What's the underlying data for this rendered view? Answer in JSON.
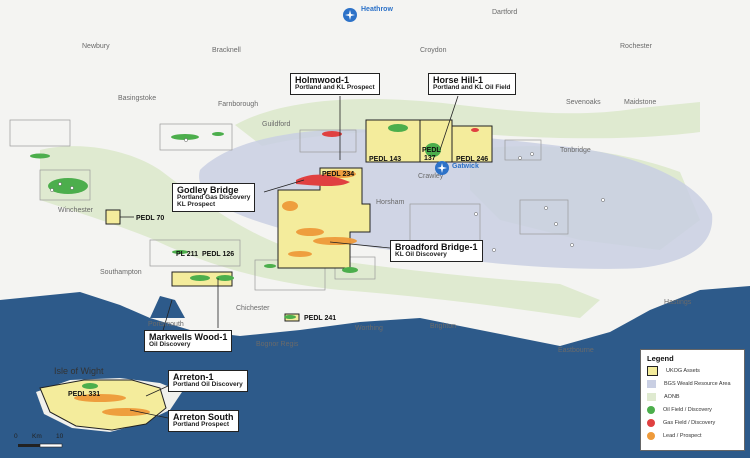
{
  "map": {
    "places": [
      {
        "id": "newbury",
        "label": "Newbury"
      },
      {
        "id": "bracknell",
        "label": "Bracknell"
      },
      {
        "id": "dartford",
        "label": "Dartford"
      },
      {
        "id": "croydon",
        "label": "Croydon"
      },
      {
        "id": "rochester",
        "label": "Rochester"
      },
      {
        "id": "basingstoke",
        "label": "Basingstoke"
      },
      {
        "id": "farnborough",
        "label": "Farnborough"
      },
      {
        "id": "guildford",
        "label": "Guildford"
      },
      {
        "id": "sevenoaks",
        "label": "Sevenoaks"
      },
      {
        "id": "maidstone",
        "label": "Maidstone"
      },
      {
        "id": "tonbridge",
        "label": "Tonbridge"
      },
      {
        "id": "crawley",
        "label": "Crawley"
      },
      {
        "id": "winchester",
        "label": "Winchester"
      },
      {
        "id": "horsham",
        "label": "Horsham"
      },
      {
        "id": "southampton",
        "label": "Southampton"
      },
      {
        "id": "portsmouth",
        "label": "Portsmouth"
      },
      {
        "id": "chichester",
        "label": "Chichester"
      },
      {
        "id": "worthing",
        "label": "Worthing"
      },
      {
        "id": "brighton",
        "label": "Brighton"
      },
      {
        "id": "hastings",
        "label": "Hastings"
      },
      {
        "id": "bognor",
        "label": "Bognor Regis"
      },
      {
        "id": "eastbourne",
        "label": "Eastbourne"
      },
      {
        "id": "isle",
        "label": "Isle of Wight"
      }
    ],
    "airports": {
      "heathrow": "Heathrow",
      "gatwick": "Gatwick"
    },
    "licences": {
      "pedl234": "PEDL 234",
      "pedl143": "PEDL 143",
      "pedl137a": "PEDL",
      "pedl137b": "137",
      "pedl246": "PEDL 246",
      "pedl70": "PEDL 70",
      "pl211": "PL 211",
      "pedl126": "PEDL 126",
      "pedl241": "PEDL 241",
      "pedl331": "PEDL 331"
    },
    "callouts": {
      "holmwood": {
        "title": "Holmwood-1",
        "sub": "Portland and KL Prospect"
      },
      "horsehill": {
        "title": "Horse Hill-1",
        "sub": "Portland and KL Oil Field"
      },
      "godley": {
        "title": "Godley Bridge",
        "sub1": "Portland Gas Discovery",
        "sub2": "KL Prospect"
      },
      "broadford": {
        "title": "Broadford Bridge-1",
        "sub": "KL Oil Discovery"
      },
      "markwells": {
        "title": "Markwells Wood-1",
        "sub": "Oil Discovery"
      },
      "arreton1": {
        "title": "Arreton-1",
        "sub": "Portland Oil Discovery"
      },
      "arretonsouth": {
        "title": "Arreton South",
        "sub": "Portland Prospect"
      }
    },
    "scale": {
      "zero": "0",
      "unit": "Km",
      "ten": "10"
    }
  },
  "legend": {
    "title": "Legend",
    "items": [
      {
        "label": "UKOG Assets",
        "color": "#f4ec9c",
        "border": "#222"
      },
      {
        "label": "BGS Weald Resource Area",
        "color": "#c9cfe3",
        "border": "#c9cfe3"
      },
      {
        "label": "AONB",
        "color": "#dfead0",
        "border": "#dfead0"
      },
      {
        "label": "Oil Field / Discovery",
        "color": "#4cae4c",
        "border": "#4cae4c"
      },
      {
        "label": "Gas Field / Discovery",
        "color": "#e04040",
        "border": "#e04040"
      },
      {
        "label": "Lead / Prospect",
        "color": "#ee9a3a",
        "border": "#ee9a3a"
      }
    ]
  }
}
